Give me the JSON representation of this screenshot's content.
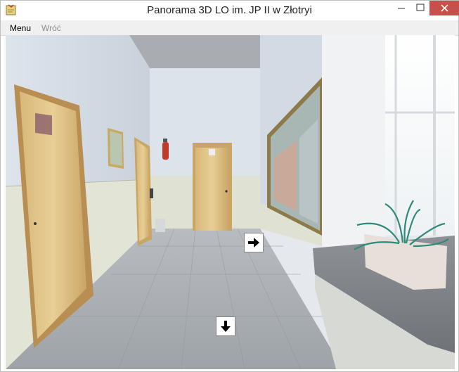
{
  "window": {
    "title": "Panorama 3D LO im. JP II w Złotryi",
    "app_icon": "sticky-note-icon",
    "controls": [
      "minimize-icon",
      "maximize-icon",
      "close-icon"
    ]
  },
  "menubar": {
    "items": [
      {
        "label": "Menu",
        "enabled": true
      },
      {
        "label": "Wróć",
        "enabled": false
      }
    ]
  },
  "panorama": {
    "scene": "school-corridor",
    "hotspots": [
      {
        "icon": "arrow-right-icon"
      },
      {
        "icon": "arrow-down-icon"
      }
    ]
  },
  "colors": {
    "close_button": "#c7504a",
    "menubar_bg": "#f0f0f0",
    "disabled_text": "#8d8d8d"
  }
}
